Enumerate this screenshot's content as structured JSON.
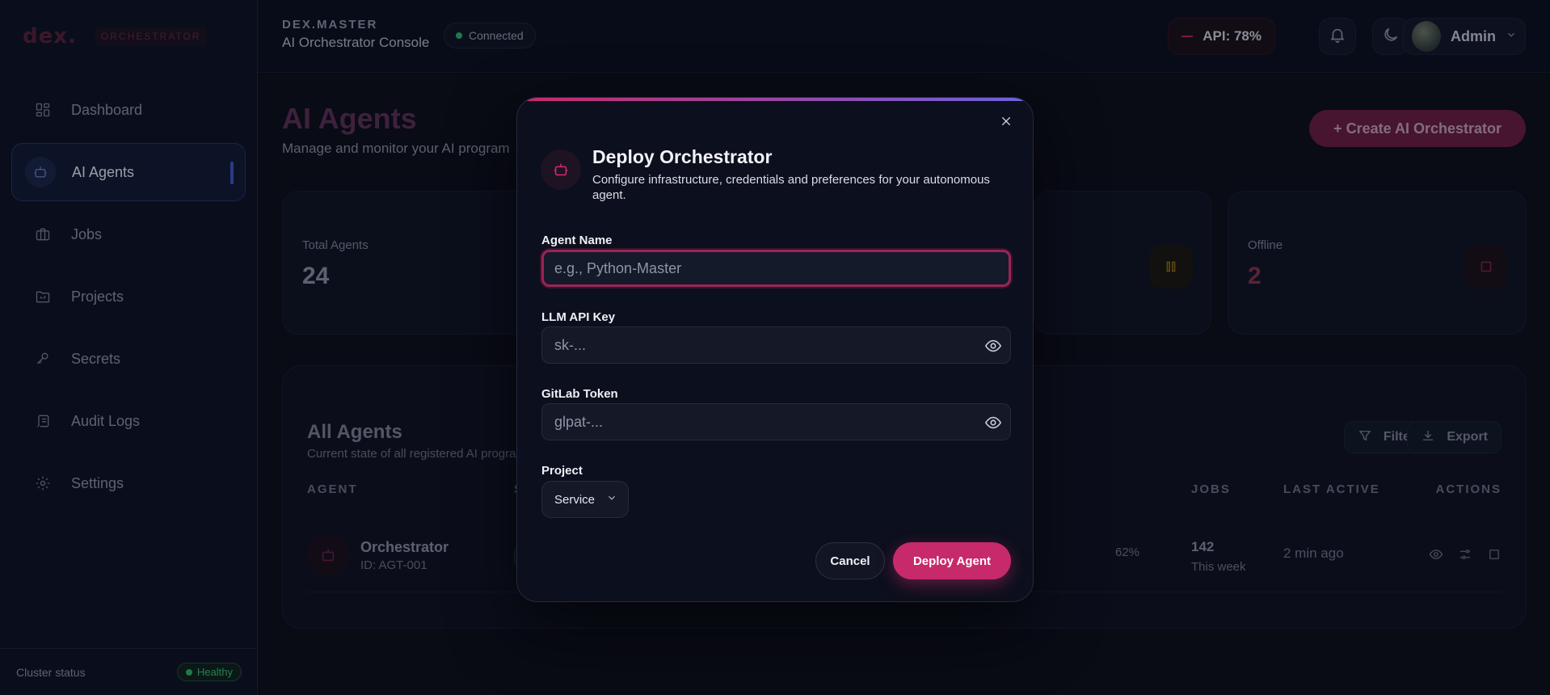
{
  "sidebar": {
    "logo_word": "dex.",
    "logo_badge": "ORCHESTRATOR",
    "items": [
      {
        "label": "Dashboard",
        "icon": "dashboard-icon"
      },
      {
        "label": "AI Agents",
        "icon": "robot-icon",
        "active": true
      },
      {
        "label": "Jobs",
        "icon": "briefcase-icon"
      },
      {
        "label": "Projects",
        "icon": "folder-icon"
      },
      {
        "label": "Secrets",
        "icon": "key-icon"
      },
      {
        "label": "Audit Logs",
        "icon": "scroll-icon"
      },
      {
        "label": "Settings",
        "icon": "gear-icon"
      }
    ],
    "cluster_label": "Cluster status",
    "cluster_status": "Healthy"
  },
  "topbar": {
    "kicker": "DEX.MASTER",
    "title": "AI Orchestrator Console",
    "connection": "Connected",
    "api_usage": "API: 78%",
    "user": "Admin"
  },
  "page": {
    "title": "AI Agents",
    "subtitle": "Manage and monitor your AI program",
    "create_button": "+ Create AI Orchestrator",
    "stats": [
      {
        "label": "Total Agents",
        "value": "24"
      },
      {
        "label": "Offline",
        "value": "2"
      }
    ],
    "table": {
      "title": "All Agents",
      "subtitle": "Current state of all registered AI progra",
      "filter": "Filter",
      "export": "Export",
      "headers": {
        "agent": "AGENT",
        "status": "S",
        "jobs": "JOBS",
        "last_active": "LAST ACTIVE",
        "actions": "ACTIONS"
      },
      "rows": [
        {
          "name": "Orchestrator",
          "id": "ID: AGT-001",
          "load": "62%",
          "jobs": "142",
          "jobs_period": "This week",
          "last_active": "2 min ago"
        }
      ]
    }
  },
  "modal": {
    "title": "Deploy Orchestrator",
    "description": "Configure infrastructure, credentials and preferences for your autonomous agent.",
    "agent_name_label": "Agent Name",
    "agent_name_placeholder": "e.g., Python-Master",
    "llm_key_label": "LLM API Key",
    "llm_key_placeholder": "sk-...",
    "gitlab_label": "GitLab Token",
    "gitlab_placeholder": "glpat-...",
    "project_label": "Project",
    "project_value": "Service",
    "cancel": "Cancel",
    "deploy": "Deploy Agent"
  },
  "colors": {
    "accent": "#c72a6b",
    "nav_active": "#3f56c4",
    "healthy": "#2fb56b"
  }
}
